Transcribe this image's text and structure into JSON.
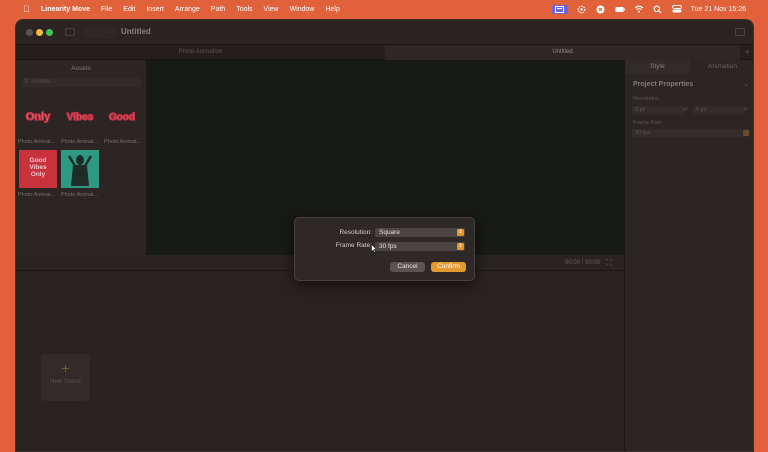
{
  "menubar": {
    "app_name": "Linearity Move",
    "items": [
      "File",
      "Edit",
      "Insert",
      "Arrange",
      "Path",
      "Tools",
      "View",
      "Window",
      "Help"
    ],
    "clock": "Tue 21 Nov  15:26",
    "status_icons": [
      "screen-mirror-icon",
      "gear-icon",
      "close-circle-icon",
      "battery-icon",
      "wifi-icon",
      "search-icon",
      "control-center-icon"
    ]
  },
  "window": {
    "title": "Untitled",
    "tabs": [
      "Photo Animation",
      "Untitled"
    ]
  },
  "assets": {
    "header": "Assets",
    "search_placeholder": "Assets",
    "items": [
      {
        "caption": "Photo Animat...",
        "thumb_text": "Only"
      },
      {
        "caption": "Photo Animat...",
        "thumb_text": "Vibes"
      },
      {
        "caption": "Photo Animat...",
        "thumb_text": "Good"
      },
      {
        "caption": "Photo Animat...",
        "thumb_text": "Good Vibes Only"
      },
      {
        "caption": "Photo Animat...",
        "thumb_text": ""
      }
    ]
  },
  "timeline": {
    "timecode": "00:00 / 00:00",
    "new_scene_label": "New Scene"
  },
  "inspector": {
    "tabs": [
      "Style",
      "Animation"
    ],
    "section_title": "Project Properties",
    "resolution_label": "Resolution",
    "width_value": "0 px",
    "width_unit": "W",
    "height_value": "0 px",
    "height_unit": "H",
    "frame_rate_label": "Frame Rate",
    "frame_rate_value": "30 fps"
  },
  "dialog": {
    "resolution_label": "Resolution:",
    "resolution_value": "Square",
    "frame_rate_label": "Frame Rate:",
    "frame_rate_value": "30 fps",
    "cancel_label": "Cancel",
    "confirm_label": "Confirm"
  },
  "colors": {
    "menubar": "#e0613a",
    "accent": "#e39a30",
    "window_bg": "#2a2322"
  }
}
